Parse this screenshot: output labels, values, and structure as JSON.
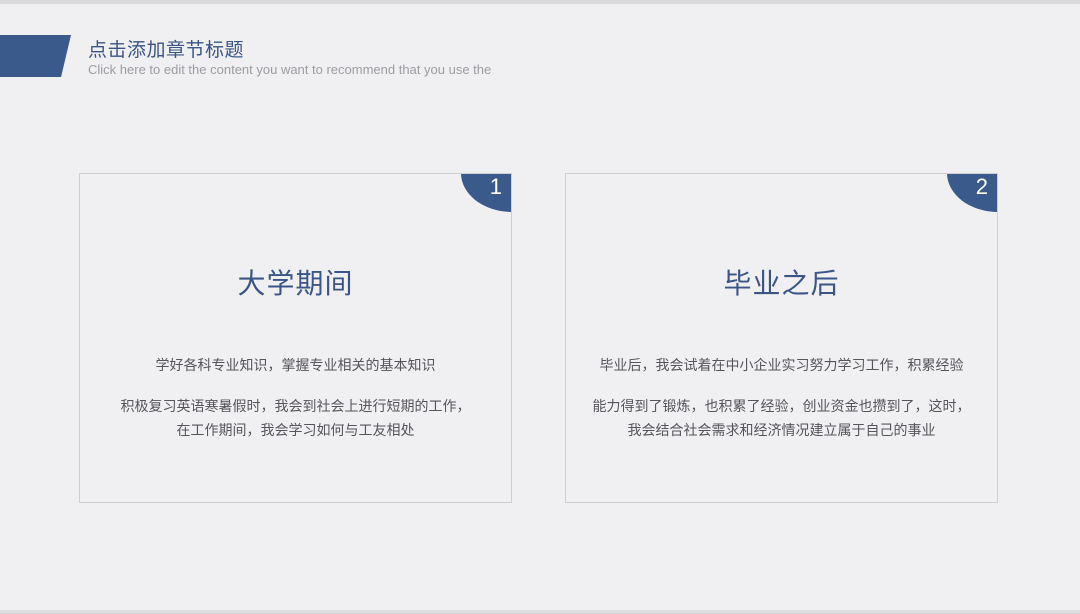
{
  "header": {
    "title": "点击添加章节标题",
    "subtitle": "Click here to edit the content you want to recommend that you use the"
  },
  "cards": [
    {
      "number": "1",
      "title": "大学期间",
      "lines": [
        "学好各科专业知识，掌握专业相关的基本知识",
        "积极复习英语寒暑假时，我会到社会上进行短期的工作，",
        "在工作期间，我会学习如何与工友相处"
      ]
    },
    {
      "number": "2",
      "title": "毕业之后",
      "lines": [
        "毕业后，我会试着在中小企业实习努力学习工作，积累经验",
        "能力得到了锻炼，也积累了经验，创业资金也攒到了，这时，",
        "我会结合社会需求和经济情况建立属于自己的事业"
      ]
    }
  ],
  "colors": {
    "accent": "#3b5a8c",
    "title_text": "#3a5586",
    "body_text": "#55555b",
    "subtitle_text": "#9c9ca2",
    "background": "#f0f0f2",
    "card_border": "#cfcfd3"
  }
}
